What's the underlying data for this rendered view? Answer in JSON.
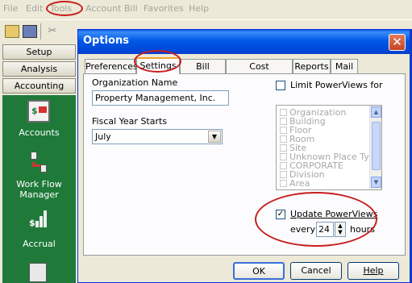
{
  "menu": [
    "File",
    "Edit",
    "Tools",
    "Account",
    "Bill",
    "Favorites",
    "Help"
  ],
  "nav": {
    "buttons": [
      "Setup",
      "Analysis",
      "Accounting"
    ],
    "items": [
      "Accounts",
      "Work Flow Manager",
      "Accrual"
    ]
  },
  "dialog": {
    "title": "Options",
    "close_label": "✕",
    "tabs": [
      "Preferences",
      "Settings",
      "Bill Images",
      "Cost Avoidance",
      "Reports",
      "Mail"
    ],
    "active_tab": "Settings",
    "org_label": "Organization Name",
    "org_value": "Property Management, Inc.",
    "fy_label": "Fiscal Year Starts",
    "fy_value": "July",
    "limit_label": "Limit PowerViews for",
    "limit_checked": false,
    "list_items": [
      "Organization",
      "Building",
      "Floor",
      "Room",
      "Site",
      "Unknown Place Type",
      "CORPORATE",
      "Division",
      "Area"
    ],
    "update_label": "Update PowerViews",
    "update_checked": true,
    "every_label": "every",
    "every_value": "24",
    "hours_label": "hours",
    "buttons": {
      "ok": "OK",
      "cancel": "Cancel",
      "help": "Help"
    }
  },
  "colors": {
    "nav_green": "#1f7a3a",
    "title_blue": "#0058e6",
    "annotation_red": "#c81e1e"
  }
}
